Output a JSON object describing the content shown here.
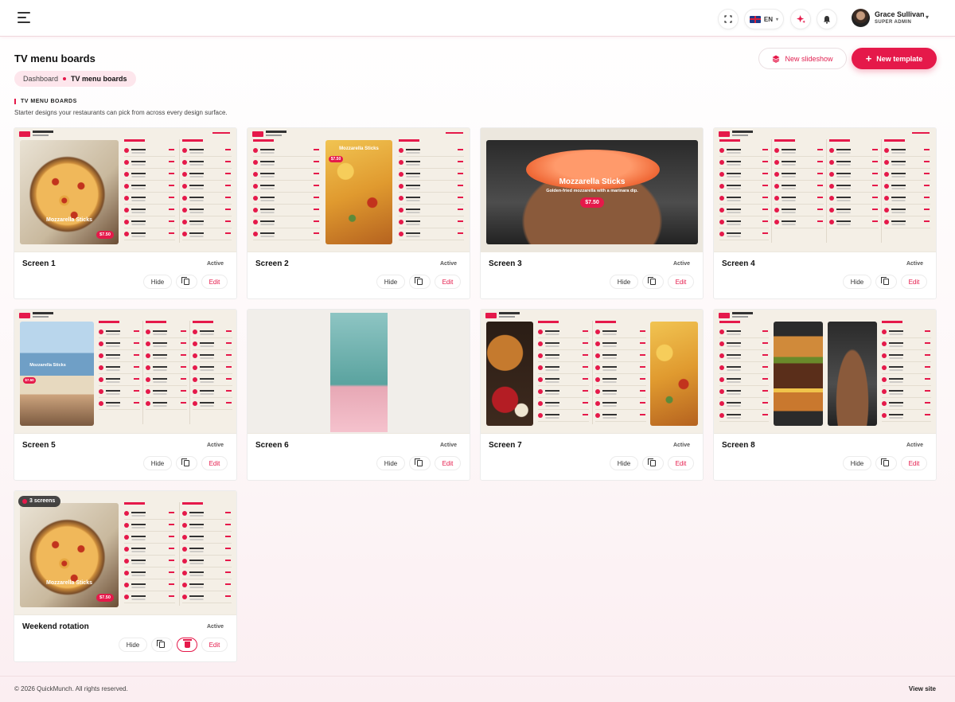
{
  "header": {
    "language": "EN",
    "user_name": "Grace Sullivan",
    "user_role": "SUPER ADMIN"
  },
  "page": {
    "title": "TV menu boards",
    "btn_slideshow": "New slideshow",
    "btn_template": "New template"
  },
  "breadcrumb": {
    "home": "Dashboard",
    "current": "TV menu boards"
  },
  "section": {
    "title": "TV MENU BOARDS",
    "description": "Starter designs your restaurants can pick from across every design surface."
  },
  "cards": [
    {
      "name": "Screen 1",
      "status": "Active",
      "hide": "Hide",
      "edit": "Edit",
      "overlay": "Mozzarella Sticks",
      "price": "$7.50"
    },
    {
      "name": "Screen 2",
      "status": "Active",
      "hide": "Hide",
      "edit": "Edit",
      "overlay": "Mozzarella Sticks",
      "price": "$7.50"
    },
    {
      "name": "Screen 3",
      "status": "Active",
      "hide": "Hide",
      "edit": "Edit",
      "overlay": "Mozzarella Sticks",
      "sub": "Golden-fried mozzarella with a marinara dip.",
      "price": "$7.50"
    },
    {
      "name": "Screen 4",
      "status": "Active",
      "hide": "Hide",
      "edit": "Edit"
    },
    {
      "name": "Screen 5",
      "status": "Active",
      "hide": "Hide",
      "edit": "Edit",
      "overlay": "Mozzarella Sticks",
      "price": "$7.50"
    },
    {
      "name": "Screen 6",
      "status": "Active",
      "hide": "Hide",
      "edit": "Edit"
    },
    {
      "name": "Screen 7",
      "status": "Active",
      "hide": "Hide",
      "edit": "Edit"
    },
    {
      "name": "Screen 8",
      "status": "Active",
      "hide": "Hide",
      "edit": "Edit"
    },
    {
      "name": "Weekend rotation",
      "status": "Active",
      "hide": "Hide",
      "edit": "Edit",
      "badge": "3 screens",
      "overlay": "Mozzarella Sticks",
      "price": "$7.50"
    }
  ],
  "footer": {
    "copyright": "© 2026 QuickMunch. All rights reserved.",
    "view_site": "View site"
  },
  "colors": {
    "accent": "#e5194a",
    "background": "#fdf7f8"
  },
  "icons": [
    "menu-icon",
    "fullscreen-icon",
    "flag-uk-icon",
    "sparkle-icon",
    "bell-icon",
    "chevron-down-icon",
    "layers-icon",
    "plus-icon",
    "copy-icon",
    "trash-icon"
  ]
}
